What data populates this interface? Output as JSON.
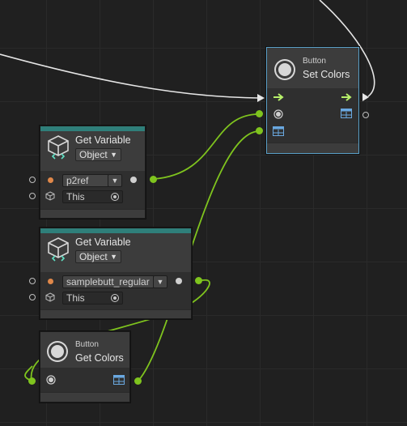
{
  "colors": {
    "background": "#202020",
    "node_body": "#393939",
    "teal_header": "#2f7f7a",
    "wire_green": "#7fc41e",
    "wire_white": "#e6e6e6",
    "selection": "#5aa0c8"
  },
  "nodes": {
    "set_colors": {
      "subtitle": "Button",
      "title": "Set Colors",
      "icon": "radio-button-icon"
    },
    "get_variable_1": {
      "title": "Get Variable",
      "kind_dropdown": "Object",
      "name_value": "p2ref",
      "target_value": "This",
      "icon": "variable-cube-icon"
    },
    "get_variable_2": {
      "title": "Get Variable",
      "kind_dropdown": "Object",
      "name_value": "samplebutt_regular",
      "target_value": "This",
      "icon": "variable-cube-icon"
    },
    "get_colors": {
      "subtitle": "Button",
      "title": "Get Colors",
      "icon": "radio-button-icon"
    }
  }
}
